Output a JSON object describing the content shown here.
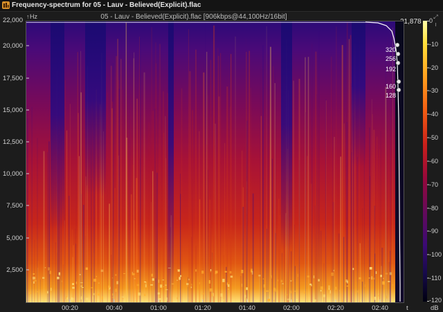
{
  "window": {
    "title": "Frequency-spectrum for 05 - Lauv - Believed(Explicit).flac"
  },
  "plot": {
    "title": "05 - Lauv - Believed(Explicit).flac [906kbps@44,100Hz/16bit]",
    "y_unit": "Hz",
    "x_unit": "t",
    "peak_frequency": "21,878"
  },
  "y_axis": {
    "labels": [
      "22,000",
      "20,000",
      "17,500",
      "15,000",
      "12,500",
      "10,000",
      "7,500",
      "5,000",
      "2,500"
    ]
  },
  "x_axis": {
    "labels": [
      "00:20",
      "00:40",
      "01:00",
      "01:20",
      "01:40",
      "02:00",
      "02:20",
      "02:40"
    ]
  },
  "bitrate_markers": [
    "320",
    "256",
    "192",
    "160",
    "128"
  ],
  "colorbar": {
    "unit": "dB",
    "labels": [
      "0",
      "-10",
      "-20",
      "-30",
      "-40",
      "-50",
      "-60",
      "-70",
      "-80",
      "-90",
      "-100",
      "-110",
      "-120"
    ]
  },
  "chart_data": {
    "type": "heatmap",
    "title": "05 - Lauv - Believed(Explicit).flac [906kbps@44,100Hz/16bit]",
    "xlabel": "t",
    "ylabel": "Hz",
    "xlim": [
      "00:00",
      "02:52"
    ],
    "ylim": [
      0,
      22000
    ],
    "zlim": [
      -120,
      0
    ],
    "zlabel": "dB",
    "y_ticks": [
      2500,
      5000,
      7500,
      10000,
      12500,
      15000,
      17500,
      20000,
      22000
    ],
    "x_ticks": [
      "00:20",
      "00:40",
      "01:00",
      "01:20",
      "01:40",
      "02:00",
      "02:20",
      "02:40"
    ],
    "spectrum_cutoff_hz": 21878,
    "bitrate_reference_kbps": [
      320,
      256,
      192,
      160,
      128
    ]
  }
}
